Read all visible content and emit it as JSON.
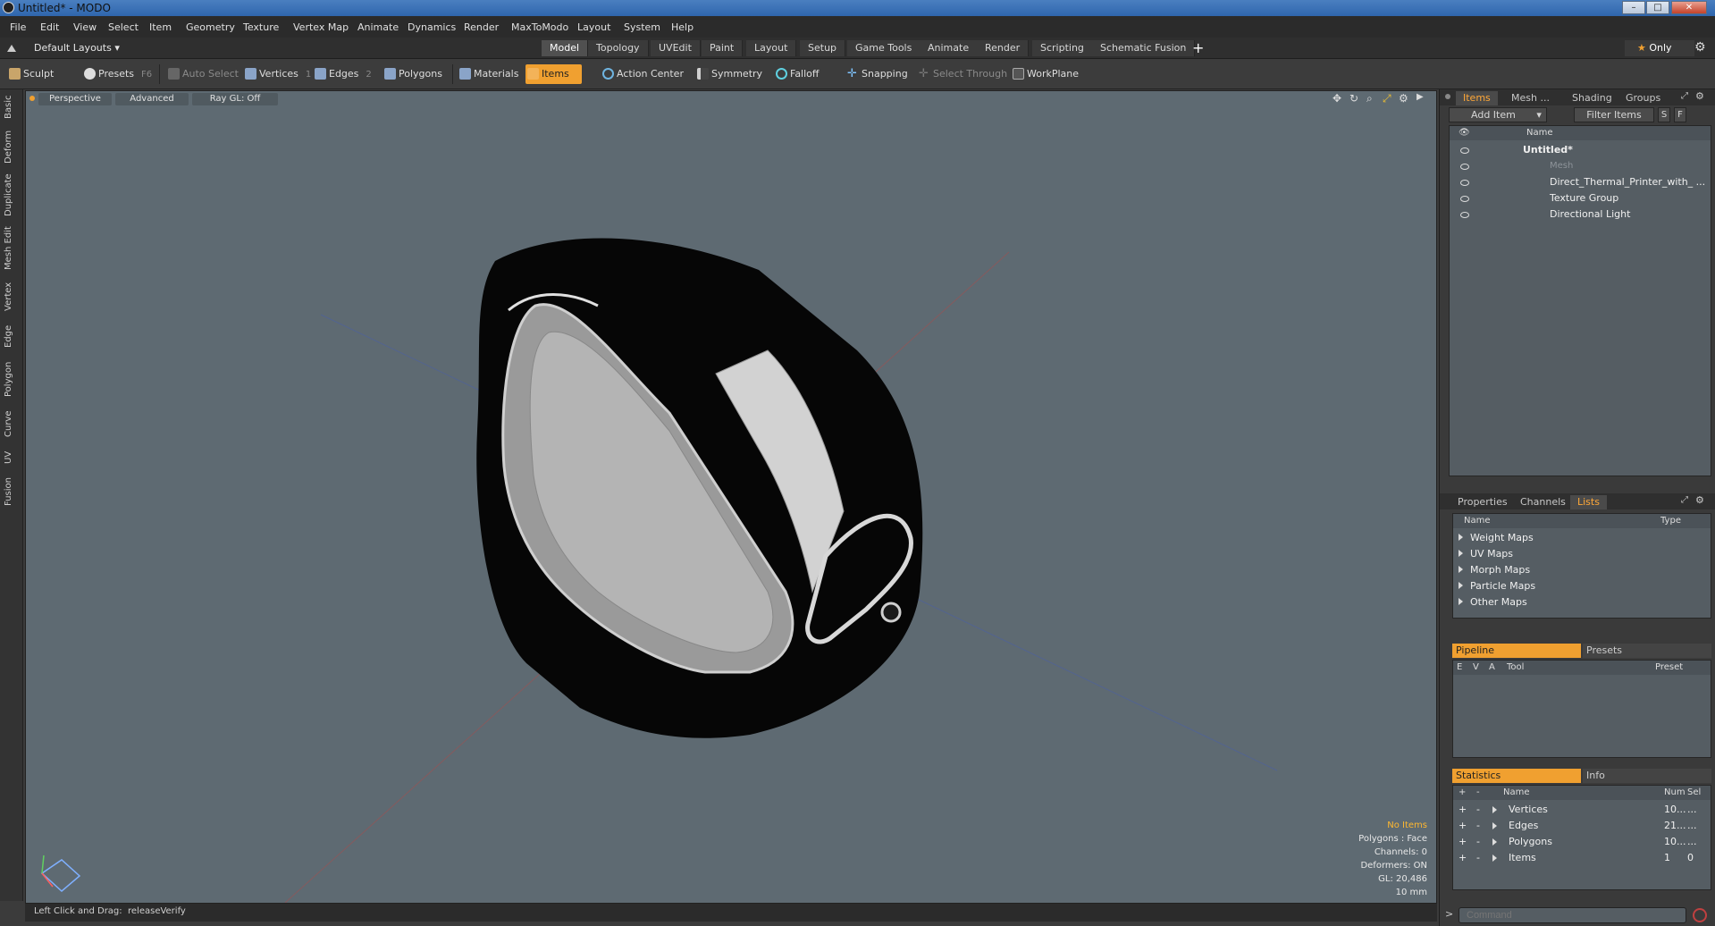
{
  "window": {
    "title": "Untitled* - MODO",
    "minimize": "–",
    "maximize": "□",
    "close": "✕"
  },
  "menu": [
    "File",
    "Edit",
    "View",
    "Select",
    "Item",
    "Geometry",
    "Texture",
    "Vertex Map",
    "Animate",
    "Dynamics",
    "Render",
    "MaxToModo",
    "Layout",
    "System",
    "Help"
  ],
  "layout": {
    "preset": "Default Layouts",
    "tabs": [
      "Model",
      "Topology",
      "UVEdit",
      "Paint",
      "Layout",
      "Setup",
      "Game Tools",
      "Animate",
      "Render",
      "Scripting",
      "Schematic Fusion"
    ],
    "active_tab": "Model",
    "add": "+",
    "only": "Only"
  },
  "toolbar": {
    "sculpt": "Sculpt",
    "presets": "Presets",
    "presets_key": "F6",
    "auto_select": "Auto Select",
    "vertices": "Vertices",
    "vertices_key": "1",
    "edges": "Edges",
    "edges_key": "2",
    "polygons": "Polygons",
    "materials": "Materials",
    "items": "Items",
    "action_center": "Action Center",
    "symmetry": "Symmetry",
    "falloff": "Falloff",
    "snapping": "Snapping",
    "select_through": "Select Through",
    "workplane": "WorkPlane"
  },
  "left_tabs": [
    "Basic",
    "Deform",
    "Duplicate",
    "Mesh Edit",
    "Vertex",
    "Edge",
    "Polygon",
    "Curve",
    "UV",
    "Fusion"
  ],
  "viewport": {
    "view": "Perspective",
    "advanced": "Advanced",
    "raygl": "Ray GL: Off",
    "info": {
      "no_items": "No Items",
      "polygons": "Polygons : Face",
      "channels": "Channels: 0",
      "deformers": "Deformers: ON",
      "gl": "GL: 20,486",
      "scale": "10 mm"
    }
  },
  "status": {
    "hint": "Left Click and Drag:",
    "action": "releaseVerify"
  },
  "items_panel": {
    "tabs": [
      "Items",
      "Mesh ...",
      "Shading",
      "Groups"
    ],
    "active_tab": "Items",
    "add_item": "Add Item",
    "filter": "Filter Items",
    "s": "S",
    "f": "F",
    "col_name": "Name",
    "tree": [
      {
        "label": "Untitled*",
        "indent": 0
      },
      {
        "label": "Mesh",
        "indent": 1
      },
      {
        "label": "Direct_Thermal_Printer_with_ ...",
        "indent": 1
      },
      {
        "label": "Texture Group",
        "indent": 1
      },
      {
        "label": "Directional Light",
        "indent": 1
      }
    ]
  },
  "props_panel": {
    "tabs": [
      "Properties",
      "Channels",
      "Lists"
    ],
    "active_tab": "Lists",
    "col_name": "Name",
    "col_type": "Type",
    "rows": [
      "Weight Maps",
      "UV Maps",
      "Morph Maps",
      "Particle Maps",
      "Other Maps"
    ]
  },
  "pipeline": {
    "tab": "Pipeline",
    "presets": "Presets",
    "cols": [
      "E",
      "V",
      "A",
      "Tool",
      "Preset"
    ]
  },
  "statistics": {
    "tab": "Statistics",
    "info": "Info",
    "cols": [
      "+",
      "-",
      "Name",
      "Num",
      "Sel"
    ],
    "rows": [
      {
        "name": "Vertices",
        "num": "10...",
        "sel": "..."
      },
      {
        "name": "Edges",
        "num": "21...",
        "sel": "..."
      },
      {
        "name": "Polygons",
        "num": "10...",
        "sel": "..."
      },
      {
        "name": "Items",
        "num": "1",
        "sel": "0"
      }
    ]
  },
  "command": {
    "placeholder": "Command"
  },
  "colors": {
    "accent": "#f0a030",
    "viewport_bg": "#5e6a72",
    "panel_bg": "#555d63"
  }
}
